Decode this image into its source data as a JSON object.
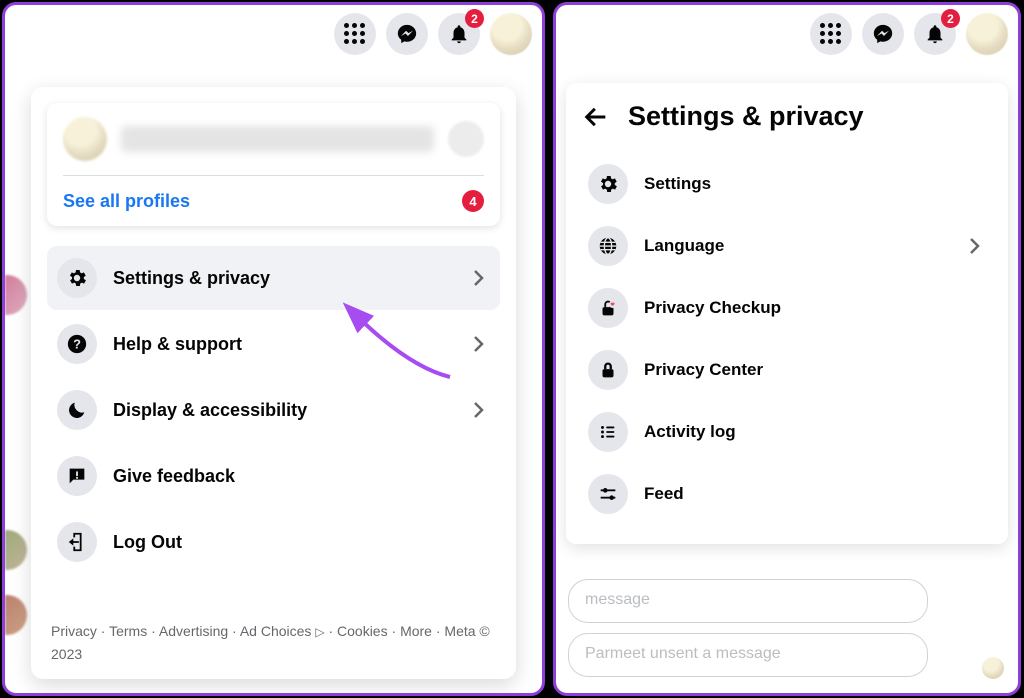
{
  "colors": {
    "accent": "#1877f2",
    "badge": "#e41e3f",
    "annotation": "#a64cf0"
  },
  "topbar": {
    "notification_badge": "2"
  },
  "left": {
    "profile": {
      "see_all_label": "See all profiles",
      "profile_badge": "4"
    },
    "menu": [
      {
        "id": "settings-privacy",
        "icon": "gear-icon",
        "label": "Settings & privacy",
        "has_chevron": true,
        "highlight": true
      },
      {
        "id": "help-support",
        "icon": "question-icon",
        "label": "Help & support",
        "has_chevron": true,
        "highlight": false
      },
      {
        "id": "display-accessibility",
        "icon": "moon-icon",
        "label": "Display & accessibility",
        "has_chevron": true,
        "highlight": false
      },
      {
        "id": "give-feedback",
        "icon": "feedback-icon",
        "label": "Give feedback",
        "has_chevron": false,
        "highlight": false
      },
      {
        "id": "log-out",
        "icon": "logout-icon",
        "label": "Log Out",
        "has_chevron": false,
        "highlight": false
      }
    ],
    "footer": {
      "links": [
        "Privacy",
        "Terms",
        "Advertising",
        "Ad Choices",
        "Cookies",
        "More"
      ],
      "meta": "Meta © 2023"
    }
  },
  "right": {
    "title": "Settings & privacy",
    "menu": [
      {
        "id": "settings",
        "icon": "gear-icon",
        "label": "Settings",
        "has_chevron": false
      },
      {
        "id": "language",
        "icon": "globe-icon",
        "label": "Language",
        "has_chevron": true
      },
      {
        "id": "privacy-checkup",
        "icon": "lock-heart-icon",
        "label": "Privacy Checkup",
        "has_chevron": false
      },
      {
        "id": "privacy-center",
        "icon": "lock-icon",
        "label": "Privacy Center",
        "has_chevron": false
      },
      {
        "id": "activity-log",
        "icon": "list-icon",
        "label": "Activity log",
        "has_chevron": false
      },
      {
        "id": "feed",
        "icon": "sliders-icon",
        "label": "Feed",
        "has_chevron": false
      }
    ],
    "messages": [
      "message",
      "Parmeet unsent a message"
    ]
  }
}
